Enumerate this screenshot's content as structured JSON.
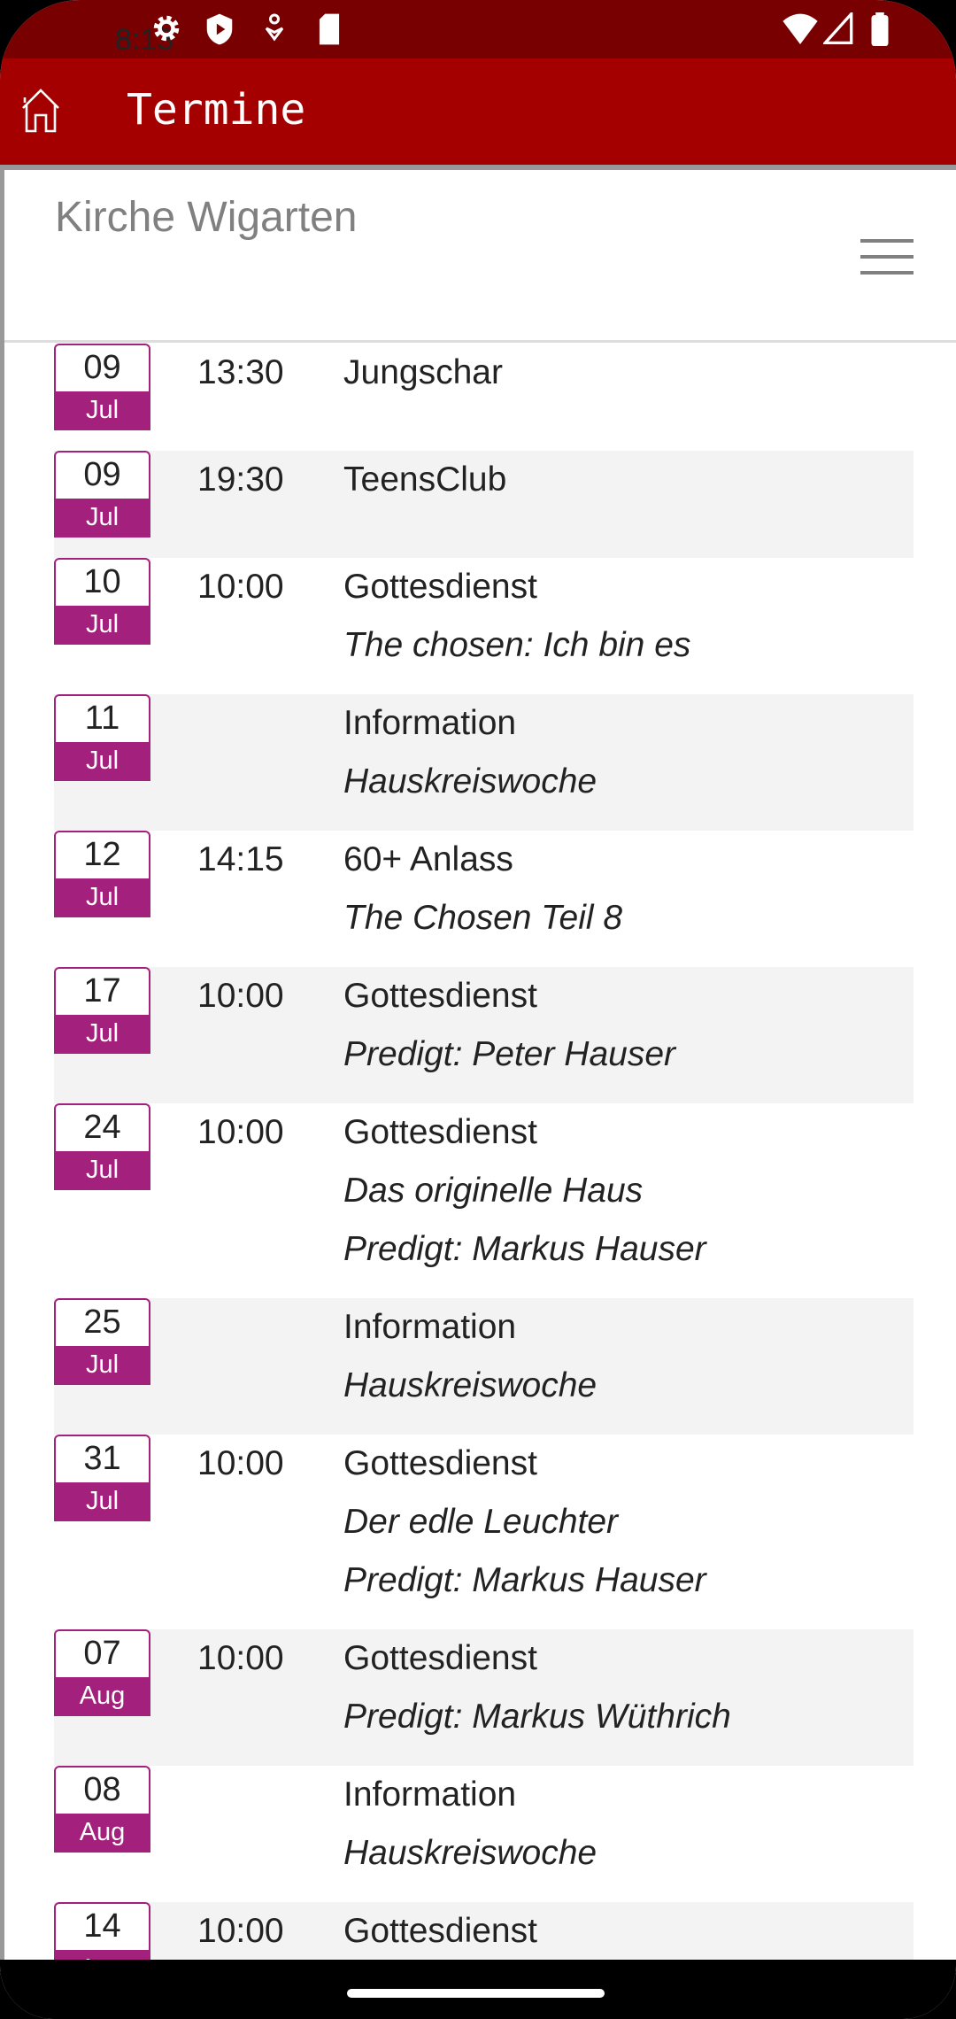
{
  "status_bar": {
    "time": "8:13",
    "icons": [
      "gear-icon",
      "shield-play-icon",
      "accessibility-icon",
      "sd-card-icon",
      "wifi-icon",
      "signal-icon",
      "battery-icon"
    ]
  },
  "app_bar": {
    "title": "Termine",
    "icon": "home-icon"
  },
  "header": {
    "site_title": "Kirche Wigarten",
    "menu_icon": "hamburger-menu-icon"
  },
  "colors": {
    "status_bar": "#780000",
    "app_bar": "#a50000",
    "date_badge": "#a3207c",
    "row_alt": "#f3f3f3"
  },
  "events": [
    {
      "day": "09",
      "month": "Jul",
      "time": "13:30",
      "title": "Jungschar",
      "details": []
    },
    {
      "day": "09",
      "month": "Jul",
      "time": "19:30",
      "title": "TeensClub",
      "details": []
    },
    {
      "day": "10",
      "month": "Jul",
      "time": "10:00",
      "title": "Gottesdienst",
      "details": [
        "The chosen: Ich bin es"
      ]
    },
    {
      "day": "11",
      "month": "Jul",
      "time": "",
      "title": "Information",
      "details": [
        "Hauskreiswoche"
      ]
    },
    {
      "day": "12",
      "month": "Jul",
      "time": "14:15",
      "title": "60+ Anlass",
      "details": [
        "The Chosen Teil 8"
      ]
    },
    {
      "day": "17",
      "month": "Jul",
      "time": "10:00",
      "title": "Gottesdienst",
      "details": [
        "Predigt: Peter Hauser"
      ]
    },
    {
      "day": "24",
      "month": "Jul",
      "time": "10:00",
      "title": "Gottesdienst",
      "details": [
        "Das originelle Haus",
        "Predigt: Markus Hauser"
      ]
    },
    {
      "day": "25",
      "month": "Jul",
      "time": "",
      "title": "Information",
      "details": [
        "Hauskreiswoche"
      ]
    },
    {
      "day": "31",
      "month": "Jul",
      "time": "10:00",
      "title": "Gottesdienst",
      "details": [
        "Der edle Leuchter",
        "Predigt: Markus Hauser"
      ]
    },
    {
      "day": "07",
      "month": "Aug",
      "time": "10:00",
      "title": "Gottesdienst",
      "details": [
        "Predigt: Markus Wüthrich"
      ]
    },
    {
      "day": "08",
      "month": "Aug",
      "time": "",
      "title": "Information",
      "details": [
        "Hauskreiswoche"
      ]
    },
    {
      "day": "14",
      "month": "Aug",
      "time": "10:00",
      "title": "Gottesdienst",
      "details": []
    }
  ]
}
